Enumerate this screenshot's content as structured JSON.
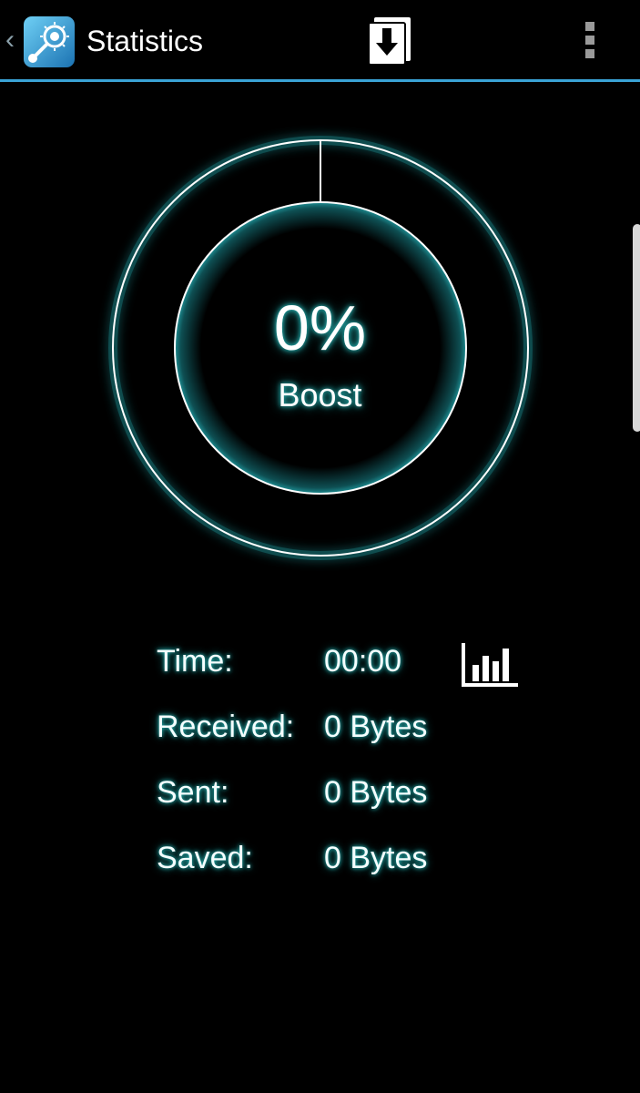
{
  "action_bar": {
    "title": "Statistics",
    "buttons": [
      {
        "icon": "download-icon"
      },
      {
        "icon": "bar-chart-icon"
      },
      {
        "icon": "overflow-menu-icon"
      }
    ],
    "accent_color": "#3aa3d6"
  },
  "gauge": {
    "value_text": "0%",
    "label": "Boost",
    "boost_percent": 0,
    "glow_color": "#2fd3d3"
  },
  "stats": [
    {
      "key": "Time:",
      "value": "00:00"
    },
    {
      "key": "Received:",
      "value": "0 Bytes"
    },
    {
      "key": "Sent:",
      "value": "0 Bytes"
    },
    {
      "key": "Saved:",
      "value": "0 Bytes"
    }
  ]
}
